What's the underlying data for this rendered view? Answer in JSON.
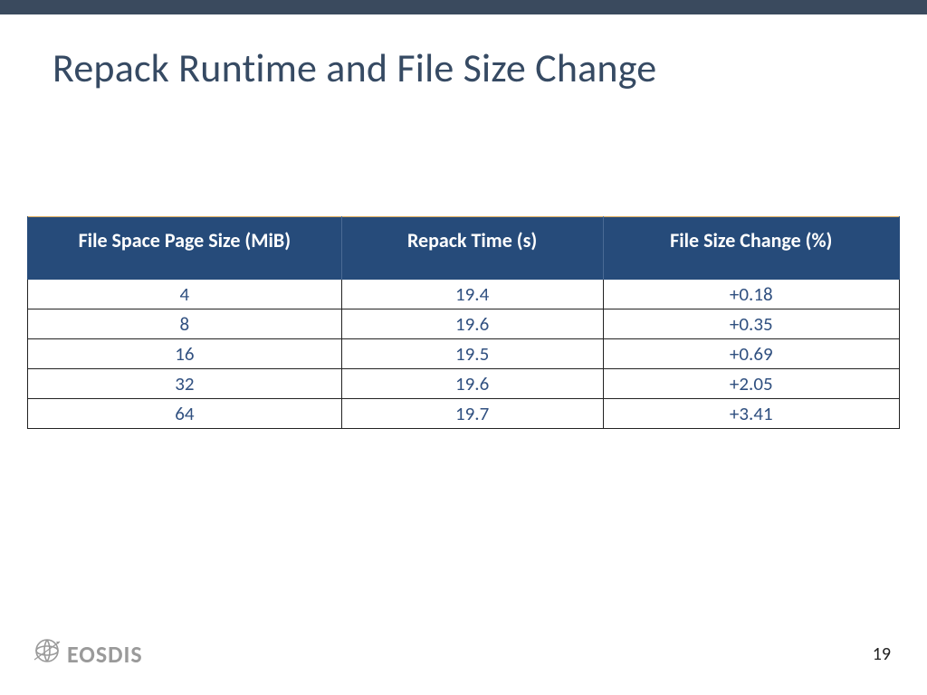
{
  "title": "Repack Runtime and File Size Change",
  "table": {
    "headers": [
      "File Space Page Size (MiB)",
      "Repack Time (s)",
      "File Size Change (%)"
    ],
    "rows": [
      [
        "4",
        "19.4",
        "+0.18"
      ],
      [
        "8",
        "19.6",
        "+0.35"
      ],
      [
        "16",
        "19.5",
        "+0.69"
      ],
      [
        "32",
        "19.6",
        "+2.05"
      ],
      [
        "64",
        "19.7",
        "+3.41"
      ]
    ]
  },
  "footer": {
    "logo_text": "EOSDIS",
    "page_number": "19"
  },
  "chart_data": {
    "type": "table",
    "columns": [
      "File Space Page Size (MiB)",
      "Repack Time (s)",
      "File Size Change (%)"
    ],
    "data": [
      {
        "page_size_mib": 4,
        "repack_time_s": 19.4,
        "file_size_change_pct": 0.18
      },
      {
        "page_size_mib": 8,
        "repack_time_s": 19.6,
        "file_size_change_pct": 0.35
      },
      {
        "page_size_mib": 16,
        "repack_time_s": 19.5,
        "file_size_change_pct": 0.69
      },
      {
        "page_size_mib": 32,
        "repack_time_s": 19.6,
        "file_size_change_pct": 2.05
      },
      {
        "page_size_mib": 64,
        "repack_time_s": 19.7,
        "file_size_change_pct": 3.41
      }
    ]
  }
}
